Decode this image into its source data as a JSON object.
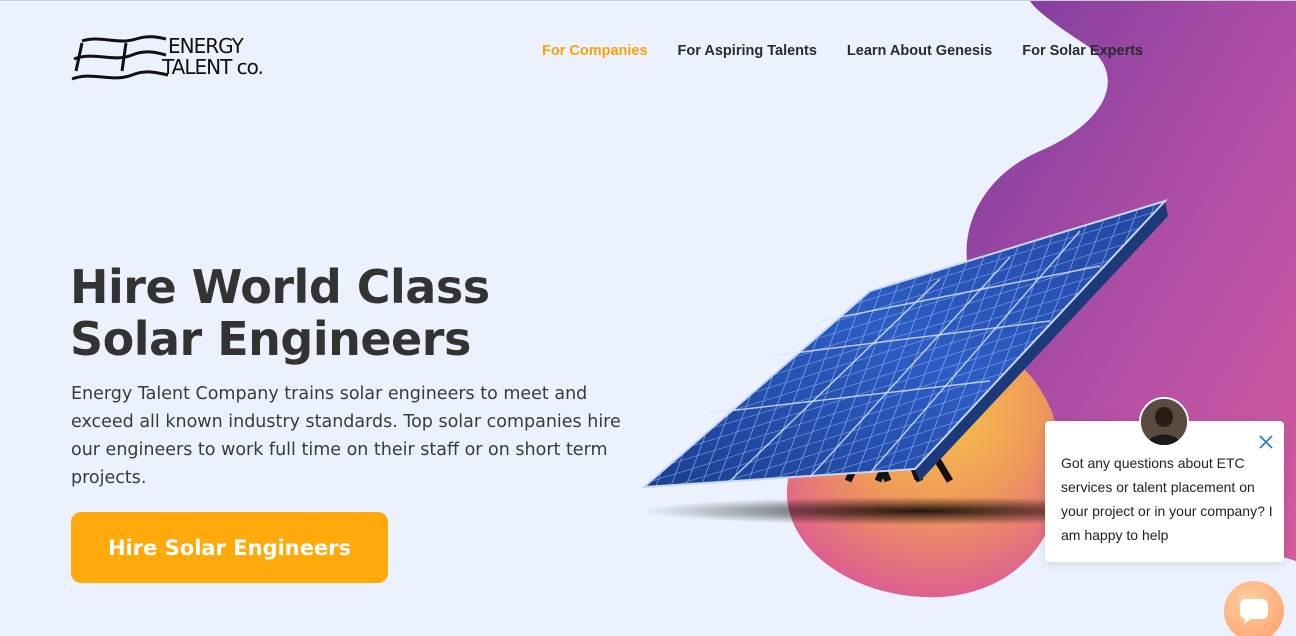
{
  "brand": {
    "logo_line1": "ENERGY",
    "logo_line2": "TALENT co."
  },
  "nav": {
    "items": [
      {
        "label": "For Companies",
        "active": true
      },
      {
        "label": "For Aspiring Talents",
        "active": false
      },
      {
        "label": "Learn About Genesis",
        "active": false
      },
      {
        "label": "For Solar Experts",
        "active": false
      }
    ]
  },
  "hero": {
    "title_line1": "Hire World Class",
    "title_line2": "Solar Engineers",
    "description": "Energy Talent Company trains solar engineers to meet and exceed all known industry standards. Top solar companies hire our engineers to work full time on their staff or on short term projects.",
    "cta_label": "Hire Solar Engineers"
  },
  "chat": {
    "message": "Got any questions about ETC services or talent placement on your project or in your company? I am happy to help"
  },
  "colors": {
    "accent": "#ffa90a",
    "nav_active": "#f5a30a",
    "background": "#ecf2fd",
    "blob_purple": "#8b3fa8",
    "blob_pink": "#d9589a",
    "blob_orange": "#f7b04a"
  },
  "icons": {
    "logo": "wave-logo-icon",
    "close": "close-icon",
    "chat": "chat-bubble-icon"
  }
}
